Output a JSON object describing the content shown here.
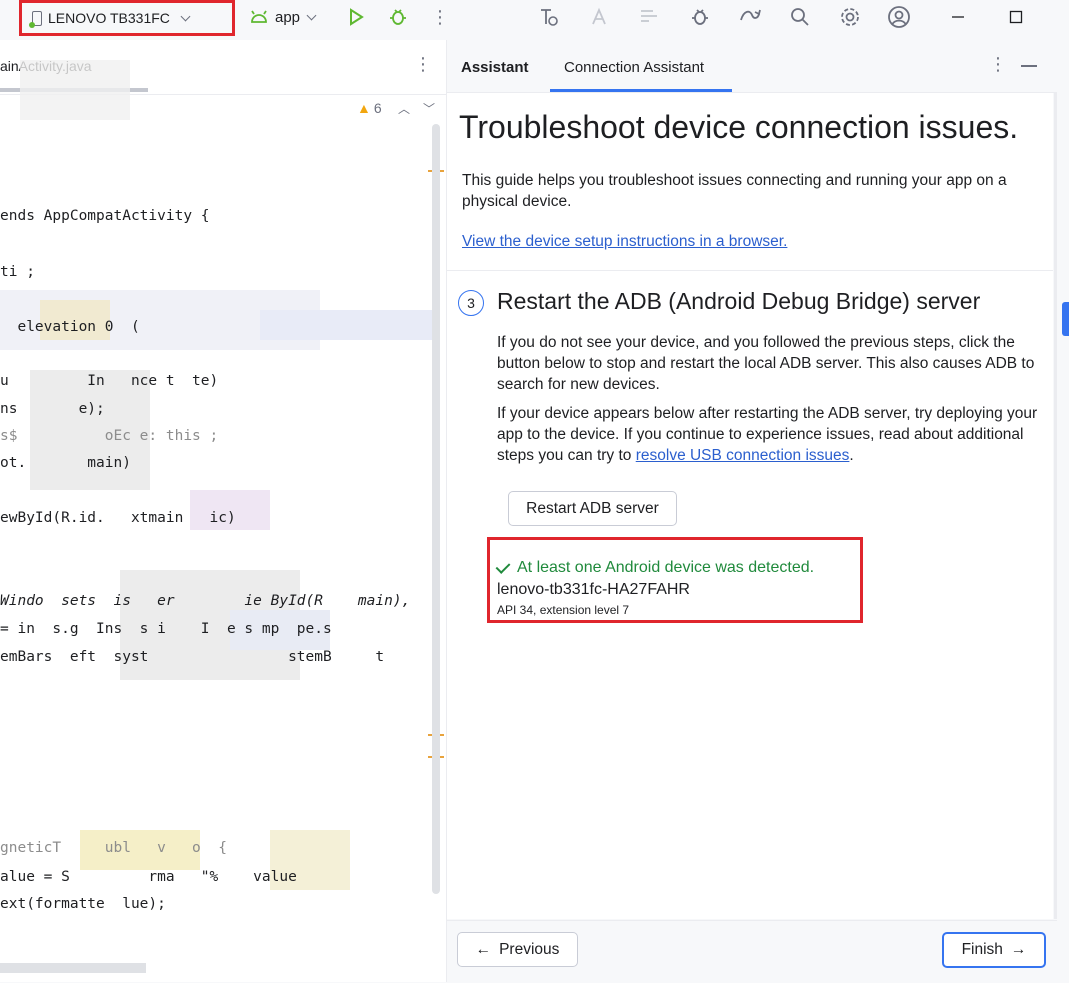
{
  "toolbar": {
    "device": "LENOVO TB331FC",
    "run_config": "app",
    "icons": [
      "run-icon",
      "debug-icon",
      "more-icon",
      "trace-icon",
      "translate-icon",
      "layout-icon",
      "bug-icon",
      "sync-icon",
      "search-icon",
      "settings-icon",
      "account-icon",
      "minimize-icon",
      "maximize-icon"
    ]
  },
  "editor": {
    "tab_label": "ainActivity.java",
    "warning_count": "6",
    "lines": [
      {
        "text": "ends AppCompatActivity {"
      },
      {
        "text": "ti ;"
      },
      {
        "text": "  elevation 0  ("
      },
      {
        "text": "u         In   nce t  te)"
      },
      {
        "text": "ns       e);"
      },
      {
        "text": "s$          oEc e: this ;"
      },
      {
        "text": "ot.       main)"
      },
      {
        "text": "ewById(R.id.   xtmain   ic)"
      },
      {
        "text": "Windo  sets  is   er        ie ById(R    main),"
      },
      {
        "text": "= in  s.g  Ins  s i    I  e s mp  pe.s"
      },
      {
        "text": "emBars  eft  syst                stemB     t"
      },
      {
        "text": "gneticT     ubl   v   o  {"
      },
      {
        "text": "alue = S         rma   \"%    value"
      },
      {
        "text": "ext(formatte  lue);"
      }
    ]
  },
  "assistant": {
    "tabs": [
      "Assistant",
      "Connection Assistant"
    ],
    "active_tab": "Connection Assistant",
    "title": "Troubleshoot device connection issues.",
    "intro": "This guide helps you troubleshoot issues connecting and running your app on a physical device.",
    "intro_link": "View the device setup instructions in a browser.",
    "step_number": "3",
    "step_title": "Restart the ADB (Android Debug Bridge) server",
    "para1": "If you do not see your device, and you followed the previous steps, click the button below to stop and restart the local ADB server. This also causes ADB to search for new devices.",
    "para2_before": "If your device appears below after restarting the ADB server, try deploying your app to the device. If you continue to experience issues, read about additional steps you can try to ",
    "para2_link": "resolve USB connection issues",
    "para2_after": ".",
    "restart_button": "Restart ADB server",
    "detected_text": "At least one Android device was detected.",
    "device_serial": "lenovo-tb331fc-HA27FAHR",
    "device_api": "API 34, extension level 7",
    "previous_button": "Previous",
    "finish_button": "Finish"
  },
  "colors": {
    "accent": "#3574f0",
    "success": "#208a3c",
    "highlight_box": "#e0262d",
    "link": "#2b5fce"
  }
}
